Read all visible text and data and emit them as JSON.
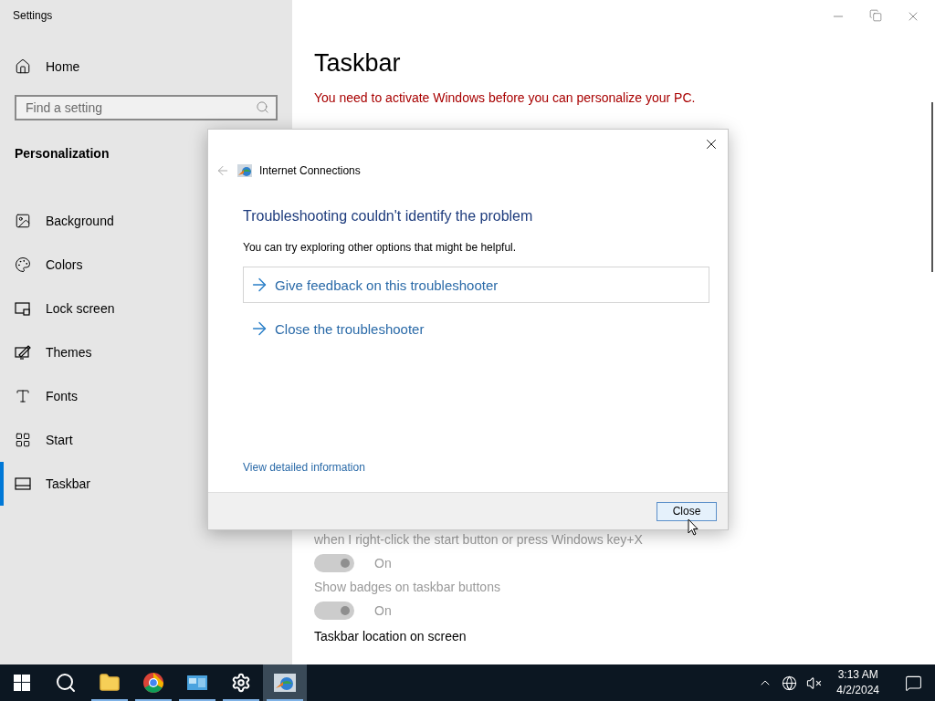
{
  "window": {
    "title": "Settings"
  },
  "sidebar": {
    "home": "Home",
    "search": {
      "placeholder": "Find a setting"
    },
    "section": "Personalization",
    "items": [
      {
        "label": "Background",
        "selected": false
      },
      {
        "label": "Colors",
        "selected": false
      },
      {
        "label": "Lock screen",
        "selected": false
      },
      {
        "label": "Themes",
        "selected": false
      },
      {
        "label": "Fonts",
        "selected": false
      },
      {
        "label": "Start",
        "selected": false
      },
      {
        "label": "Taskbar",
        "selected": true
      }
    ]
  },
  "page": {
    "title": "Taskbar",
    "warning": "You need to activate Windows before you can personalize your PC.",
    "settings": [
      {
        "kind": "caption",
        "label": "when I right-click the start button or press Windows key+X",
        "disabled": true
      },
      {
        "kind": "toggle",
        "label": "On",
        "on": true,
        "disabled": true
      },
      {
        "kind": "caption",
        "label": "Show badges on taskbar buttons",
        "disabled": true
      },
      {
        "kind": "toggle",
        "label": "On",
        "on": true,
        "disabled": true
      },
      {
        "kind": "heading",
        "label": "Taskbar location on screen",
        "disabled": false
      }
    ]
  },
  "dialog": {
    "title": "Internet Connections",
    "heading": "Troubleshooting couldn't identify the problem",
    "description": "You can try exploring other options that might be helpful.",
    "options": [
      {
        "label": "Give feedback on this troubleshooter",
        "selected": true
      },
      {
        "label": "Close the troubleshooter",
        "selected": false
      }
    ],
    "details_link": "View detailed information",
    "button": "Close"
  },
  "taskbar": {
    "apps": [
      {
        "kind": "search",
        "running": false,
        "active": false
      },
      {
        "kind": "explorer",
        "running": true,
        "active": false
      },
      {
        "kind": "chrome",
        "running": true,
        "active": false
      },
      {
        "kind": "panel",
        "running": true,
        "active": false
      },
      {
        "kind": "settings",
        "running": true,
        "active": false
      },
      {
        "kind": "troubleshooter",
        "running": true,
        "active": true
      }
    ],
    "time": "3:13 AM",
    "date": "4/2/2024"
  }
}
